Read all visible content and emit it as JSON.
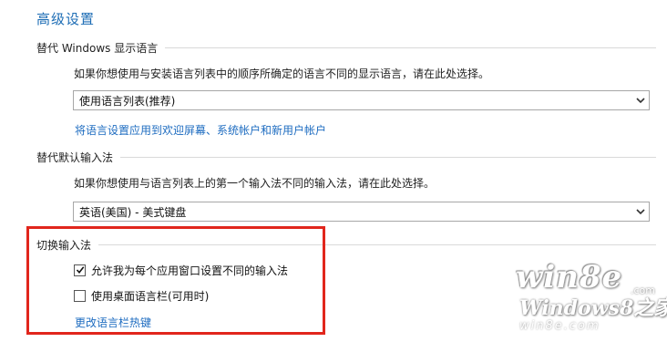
{
  "page": {
    "title": "高级设置"
  },
  "display_language": {
    "heading": "替代 Windows 显示语言",
    "description": "如果你想使用与安装语言列表中的顺序所确定的语言不同的显示语言，请在此处选择。",
    "select_value": "使用语言列表(推荐)",
    "link": "将语言设置应用到欢迎屏幕、系统帐户和新用户帐户"
  },
  "input_method": {
    "heading": "替代默认输入法",
    "description": "如果你想使用与语言列表上的第一个输入法不同的输入法，请在此处选择。",
    "select_value": "英语(美国) - 美式键盘"
  },
  "switch_input": {
    "heading": "切换输入法",
    "options": [
      {
        "label": "允许我为每个应用窗口设置不同的输入法",
        "checked": true
      },
      {
        "label": "使用桌面语言栏(可用时)",
        "checked": false
      }
    ],
    "link": "更改语言栏热键"
  },
  "watermark": {
    "logo": "win8e",
    "site": ".com",
    "tagline": "Windows8之家",
    "bottom": "win8e.com"
  },
  "colors": {
    "title": "#1d6db5",
    "link": "#1e6cc0",
    "highlight": "#e1261c"
  },
  "icons": [
    "chevron-down-icon",
    "checkmark-icon"
  ]
}
